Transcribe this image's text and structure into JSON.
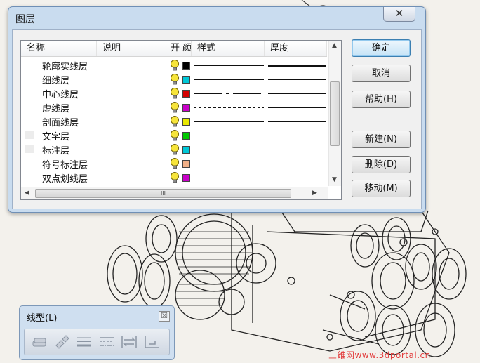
{
  "dialog": {
    "title": "图层",
    "close_glyph": "✕",
    "columns": [
      "名称",
      "说明",
      "开",
      "颜",
      "样式",
      "厚度"
    ],
    "layers": [
      {
        "name": "轮廓实线层",
        "color": "#000000",
        "style": "solid",
        "thickness": "thick"
      },
      {
        "name": "细线层",
        "color": "#00c8d8",
        "style": "solid",
        "thickness": "thin"
      },
      {
        "name": "中心线层",
        "color": "#d40000",
        "style": "center",
        "thickness": "thin"
      },
      {
        "name": "虚线层",
        "color": "#c800c8",
        "style": "dashed",
        "thickness": "thin"
      },
      {
        "name": "剖面线层",
        "color": "#e8e800",
        "style": "solid",
        "thickness": "thin"
      },
      {
        "name": "文字层",
        "color": "#00c800",
        "style": "solid",
        "thickness": "thin"
      },
      {
        "name": "标注层",
        "color": "#00c8d8",
        "style": "solid",
        "thickness": "thin"
      },
      {
        "name": "符号标注层",
        "color": "#f0b088",
        "style": "solid",
        "thickness": "thin"
      },
      {
        "name": "双点划线层",
        "color": "#c800c8",
        "style": "phantom",
        "thickness": "thin"
      }
    ],
    "hscroll_grip": "III",
    "buttons": {
      "ok": "确定",
      "cancel": "取消",
      "help": "帮助(H)",
      "new": "新建(N)",
      "delete": "删除(D)",
      "move": "移动(M)"
    }
  },
  "toolbar": {
    "title": "线型(L)",
    "close_glyph": "☒",
    "icons": [
      "layer-icon",
      "paint-brush-icon",
      "line-weight-icon",
      "line-style-icon",
      "line-swap-icon",
      "line-base-icon"
    ]
  },
  "watermark": "三维网www.3dportal.cn"
}
